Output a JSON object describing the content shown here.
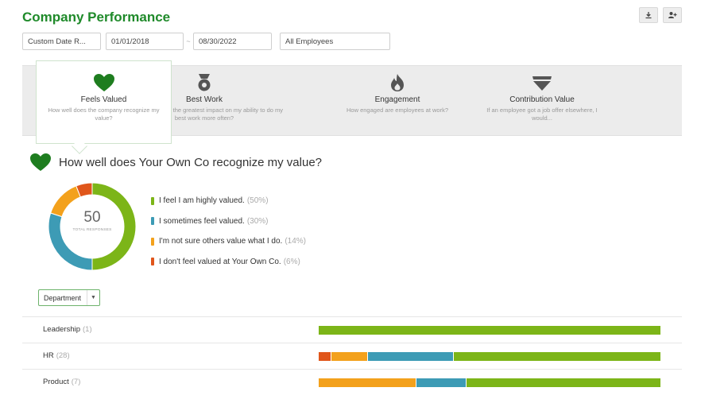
{
  "page": {
    "title": "Company Performance"
  },
  "filters": {
    "range": "Custom Date R...",
    "start_date": "01/01/2018",
    "separator": "~",
    "end_date": "08/30/2022",
    "employees": "All Employees"
  },
  "tabs": [
    {
      "id": "feels-valued",
      "label": "Feels Valued",
      "desc": "How well does the company recognize my value?",
      "icon": "heart-icon",
      "active": true
    },
    {
      "id": "best-work",
      "label": "Best Work",
      "desc": "What would have the greatest impact on my ability to do my best work more often?",
      "icon": "medal-icon",
      "active": false
    },
    {
      "id": "engagement",
      "label": "Engagement",
      "desc": "How engaged are employees at work?",
      "icon": "flame-icon",
      "active": false
    },
    {
      "id": "contribution-value",
      "label": "Contribution Value",
      "desc": "If an employee got a job offer elsewhere, I would...",
      "icon": "diamond-icon",
      "active": false
    }
  ],
  "question": {
    "title": "How well does Your Own Co recognize my value?"
  },
  "summary": {
    "total": "50",
    "total_label": "TOTAL RESPONSES"
  },
  "colors": {
    "green": "#7cb518",
    "teal": "#3d9bb5",
    "orange": "#f3a11c",
    "red": "#e0561b",
    "heart": "#1e7d1f",
    "title": "#1f8a2a"
  },
  "chart_data": {
    "type": "pie",
    "categories": [
      "I feel I am highly valued.",
      "I sometimes feel valued.",
      "I'm not sure others value what I do.",
      "I don't feel valued at Your Own Co."
    ],
    "values": [
      50,
      30,
      14,
      6
    ],
    "pct_labels": [
      "(50%)",
      "(30%)",
      "(14%)",
      "(6%)"
    ],
    "colors": [
      "#7cb518",
      "#3d9bb5",
      "#f3a11c",
      "#e0561b"
    ]
  },
  "department": {
    "label": "Department",
    "rows": [
      {
        "name": "Leadership",
        "count": "(1)",
        "segments": [
          {
            "color": "#7cb518",
            "value": 100
          }
        ]
      },
      {
        "name": "HR",
        "count": "(28)",
        "segments": [
          {
            "color": "#e0561b",
            "value": 3.5
          },
          {
            "color": "#f3a11c",
            "value": 10.5
          },
          {
            "color": "#3d9bb5",
            "value": 25
          },
          {
            "color": "#7cb518",
            "value": 61
          }
        ]
      },
      {
        "name": "Product",
        "count": "(7)",
        "segments": [
          {
            "color": "#f3a11c",
            "value": 28.6
          },
          {
            "color": "#3d9bb5",
            "value": 14.3
          },
          {
            "color": "#7cb518",
            "value": 57.1
          }
        ]
      }
    ]
  }
}
